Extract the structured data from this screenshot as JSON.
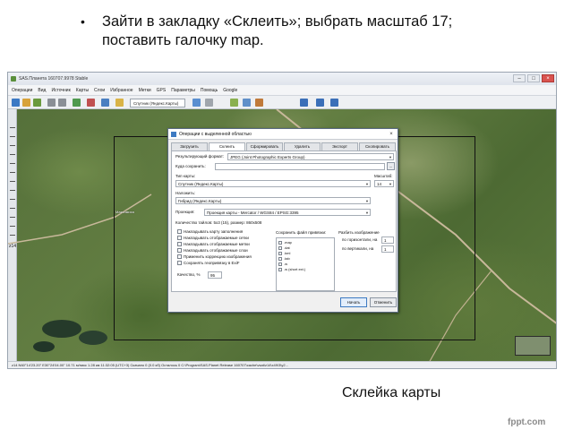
{
  "slide": {
    "bullet_lines": [
      "Зайти в закладку «Склеить»; выбрать масштаб 17;",
      "поставить галочку map."
    ],
    "caption": "Склейка карты",
    "watermark": "fppt.com"
  },
  "app": {
    "title": "SAS.Планета 160707.9978 Stable",
    "menu": [
      "Операции",
      "Вид",
      "Источник",
      "Карты",
      "Слои",
      "Избранное",
      "Метки",
      "GPS",
      "Параметры",
      "Помощь",
      "Google"
    ],
    "map_source": "Спутник (Яндекс.Карты)",
    "zoom_label": "z14",
    "status": "z14   N60°14'23.20\" E30°24'04.00\"   10.71 м/пикс   1.28 км   11:32:05 (UTC+3)   Скачано 0 (0.0 кб)   Осталось 0   C:\\Program\\SAS.Planet Release 160707\\cache\\vsat\\z14\\x49\\3\\y2..."
  },
  "dialog": {
    "title": "Операции с выделенной областью",
    "tabs": [
      "Загрузить",
      "Склеить",
      "Сформировать",
      "Удалить",
      "Экспорт",
      "Скопировать"
    ],
    "active_tab": "Склеить",
    "format_label": "Результирующий формат:",
    "format_value": "JPEG (Joint Photographic Experts Group)",
    "save_to_label": "Куда сохранить:",
    "save_to_value": "",
    "browse_label": "...",
    "map_type_label": "Тип карты:",
    "zoom_label": "Масштаб:",
    "zoom_value": "14",
    "map_type_value": "Спутник (Яндекс.Карты)",
    "overlay_label": "Наложить:",
    "overlay_value": "Гибрид (Яндекс.Карты)",
    "projection_label": "Проекция:",
    "projection_value": "Проекция карты - Mercator / WGS84 / EPSG:3395",
    "tile_count": "Количество тайлов: 5x3 (15), размер: 860x508",
    "options": [
      "Накладывать карту заполнения",
      "Накладывать отображаемые сетки",
      "Накладывать отображаемые метки",
      "Накладывать отображаемые слои",
      "Применить коррекцию изображения",
      "Сохранять геопривязку в ExiF"
    ],
    "quality_label": "Качество, %",
    "quality_value": "95",
    "bind_files_label": "Сохранить файл привязки:",
    "bind_files": [
      ".map",
      ".dat",
      ".kml",
      ".tab",
      ".w",
      ".w (short ext.)"
    ],
    "split_label": "Разбить изображение",
    "split_h_label": "по горизонтали, на",
    "split_h_value": "1",
    "split_v_label": "по вертикали, на",
    "split_v_value": "1",
    "start_button": "Начать",
    "cancel_button": "Отменить"
  }
}
